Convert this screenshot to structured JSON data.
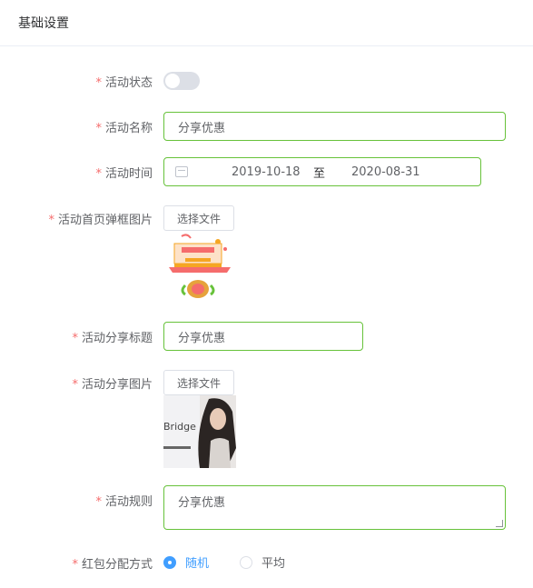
{
  "header": {
    "title": "基础设置"
  },
  "form": {
    "status": {
      "label": "活动状态",
      "enabled": false
    },
    "name": {
      "label": "活动名称",
      "value": "分享优惠"
    },
    "time": {
      "label": "活动时间",
      "start": "2019-10-18",
      "separator": "至",
      "end": "2020-08-31"
    },
    "popup_image": {
      "label": "活动首页弹框图片",
      "button": "选择文件",
      "image_icon": "red-envelope-popup-image"
    },
    "share_title": {
      "label": "活动分享标题",
      "value": "分享优惠"
    },
    "share_image": {
      "label": "活动分享图片",
      "button": "选择文件",
      "caption": "Bridge",
      "image_icon": "portrait-photo-image"
    },
    "rules": {
      "label": "活动规则",
      "value": "分享优惠"
    },
    "distribution": {
      "label": "红包分配方式",
      "options": [
        "随机",
        "平均"
      ],
      "selected": "随机"
    }
  },
  "required_mark": "*",
  "colors": {
    "accent": "#409eff",
    "valid_border": "#67c23a",
    "required": "#f56c6c"
  }
}
